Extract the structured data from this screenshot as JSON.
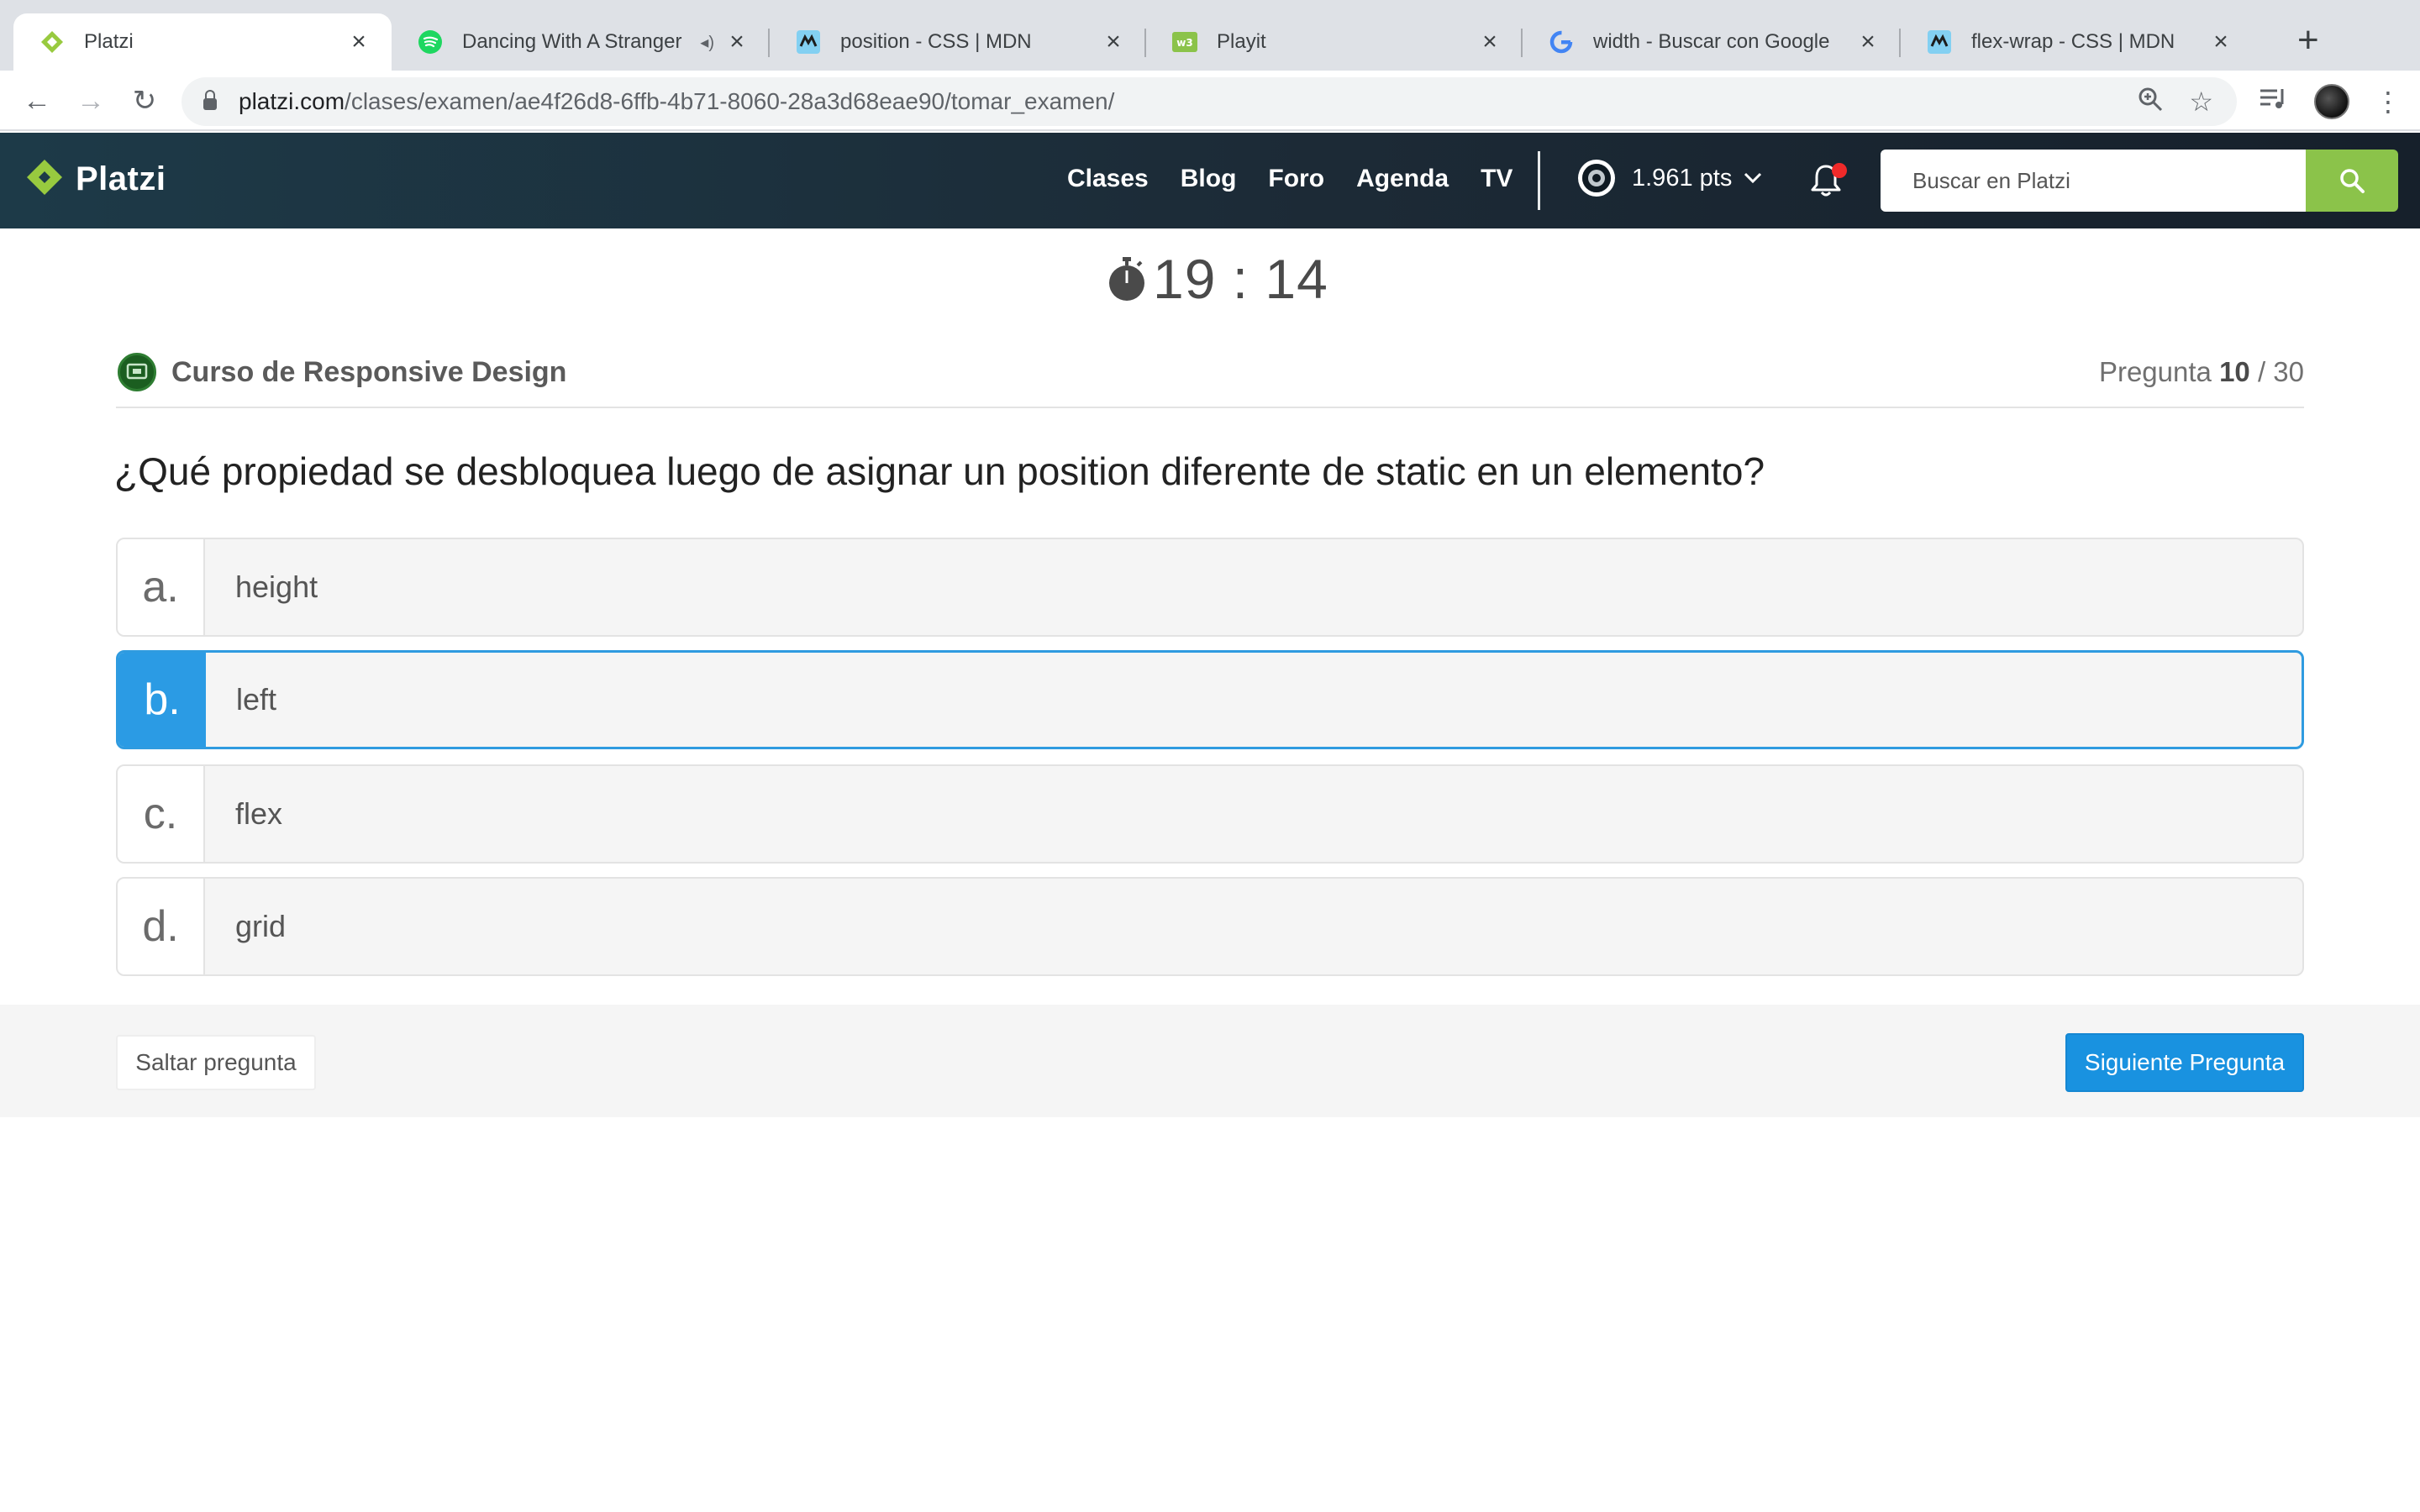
{
  "browser": {
    "tabs": [
      {
        "title": "Platzi",
        "icon": "platzi-icon"
      },
      {
        "title": "Dancing With A Stranger",
        "icon": "spotify-icon"
      },
      {
        "title": "position - CSS | MDN",
        "icon": "mdn-icon"
      },
      {
        "title": "Playit",
        "icon": "playit-icon"
      },
      {
        "title": "width - Buscar con Google",
        "icon": "google-icon"
      },
      {
        "title": "flex-wrap - CSS | MDN",
        "icon": "mdn-icon"
      }
    ],
    "url_host": "platzi.com",
    "url_path": "/clases/examen/ae4f26d8-6ffb-4b71-8060-28a3d68eae90/tomar_examen/"
  },
  "header": {
    "logo_text": "Platzi",
    "nav": [
      "Clases",
      "Blog",
      "Foro",
      "Agenda",
      "TV"
    ],
    "points": "1.961 pts",
    "search_placeholder": "Buscar en Platzi"
  },
  "exam": {
    "timer": "19 : 14",
    "course_name": "Curso de Responsive Design",
    "counter_prefix": "Pregunta",
    "current_question": "10",
    "counter_total": "/ 30",
    "question": "¿Qué propiedad se desbloquea luego de asignar un position diferente de static en un elemento?",
    "options": [
      {
        "letter": "a.",
        "text": "height",
        "selected": false
      },
      {
        "letter": "b.",
        "text": "left",
        "selected": true
      },
      {
        "letter": "c.",
        "text": "flex",
        "selected": false
      },
      {
        "letter": "d.",
        "text": "grid",
        "selected": false
      }
    ],
    "skip_label": "Saltar pregunta",
    "next_label": "Siguiente Pregunta"
  },
  "colors": {
    "header_bg": "#1c2a36",
    "accent_green": "#8bc34a",
    "selected_blue": "#2b9be4",
    "next_button": "#1992e0"
  }
}
